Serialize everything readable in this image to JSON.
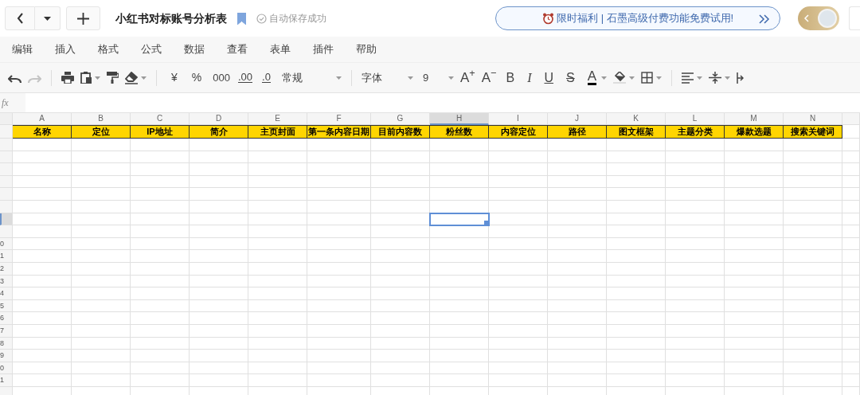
{
  "title": "小红书对标账号分析表",
  "bookmarked": true,
  "save_status": "自动保存成功",
  "promo": "限时福利 | 石墨高级付费功能免费试用!",
  "menu": [
    "编辑",
    "插入",
    "格式",
    "公式",
    "数据",
    "查看",
    "表单",
    "插件",
    "帮助"
  ],
  "toolbar": {
    "undo_disabled": false,
    "redo_disabled": true,
    "currency": "¥",
    "percent": "%",
    "thousands": "000",
    "add_decimal": ".00",
    "remove_decimal": ".0",
    "number_format": "常规",
    "font": "字体",
    "font_size": "9",
    "grow_font": "A$^{+}$",
    "shrink_font": "A$^{−}$",
    "bold": "B",
    "italic": "I",
    "underline": "U",
    "strike": "S",
    "text_color": "A"
  },
  "formula_label": "fx",
  "columns": [
    {
      "letter": "A",
      "selected": false,
      "header": "名称"
    },
    {
      "letter": "B",
      "selected": false,
      "header": "定位"
    },
    {
      "letter": "C",
      "selected": false,
      "header": "IP地址"
    },
    {
      "letter": "D",
      "selected": false,
      "header": "简介"
    },
    {
      "letter": "E",
      "selected": false,
      "header": "主页封面"
    },
    {
      "letter": "F",
      "selected": false,
      "header": "第一条内容日期"
    },
    {
      "letter": "G",
      "selected": false,
      "header": "目前内容数"
    },
    {
      "letter": "H",
      "selected": true,
      "header": "粉丝数"
    },
    {
      "letter": "I",
      "selected": false,
      "header": "内容定位"
    },
    {
      "letter": "J",
      "selected": false,
      "header": "路径"
    },
    {
      "letter": "K",
      "selected": false,
      "header": "图文框架"
    },
    {
      "letter": "L",
      "selected": false,
      "header": "主题分类"
    },
    {
      "letter": "M",
      "selected": false,
      "header": "爆款选题"
    },
    {
      "letter": "N",
      "selected": false,
      "header": "搜索关键词"
    }
  ],
  "rows": [
    {
      "selected": false
    },
    {
      "selected": false
    },
    {
      "selected": false
    },
    {
      "selected": false
    },
    {
      "selected": false
    },
    {
      "selected": false
    },
    {
      "selected": false
    },
    {
      "selected": true
    },
    {
      "selected": false
    },
    {
      "label": "0",
      "selected": false
    },
    {
      "label": "1",
      "selected": false
    },
    {
      "label": "2",
      "selected": false
    },
    {
      "label": "3",
      "selected": false
    },
    {
      "label": "4",
      "selected": false
    },
    {
      "label": "5",
      "selected": false
    },
    {
      "label": "6",
      "selected": false
    },
    {
      "label": "7",
      "selected": false
    },
    {
      "label": "8",
      "selected": false
    },
    {
      "label": "9",
      "selected": false
    },
    {
      "label": "0",
      "selected": false
    },
    {
      "label": "1",
      "selected": false
    },
    {
      "selected": false
    }
  ]
}
